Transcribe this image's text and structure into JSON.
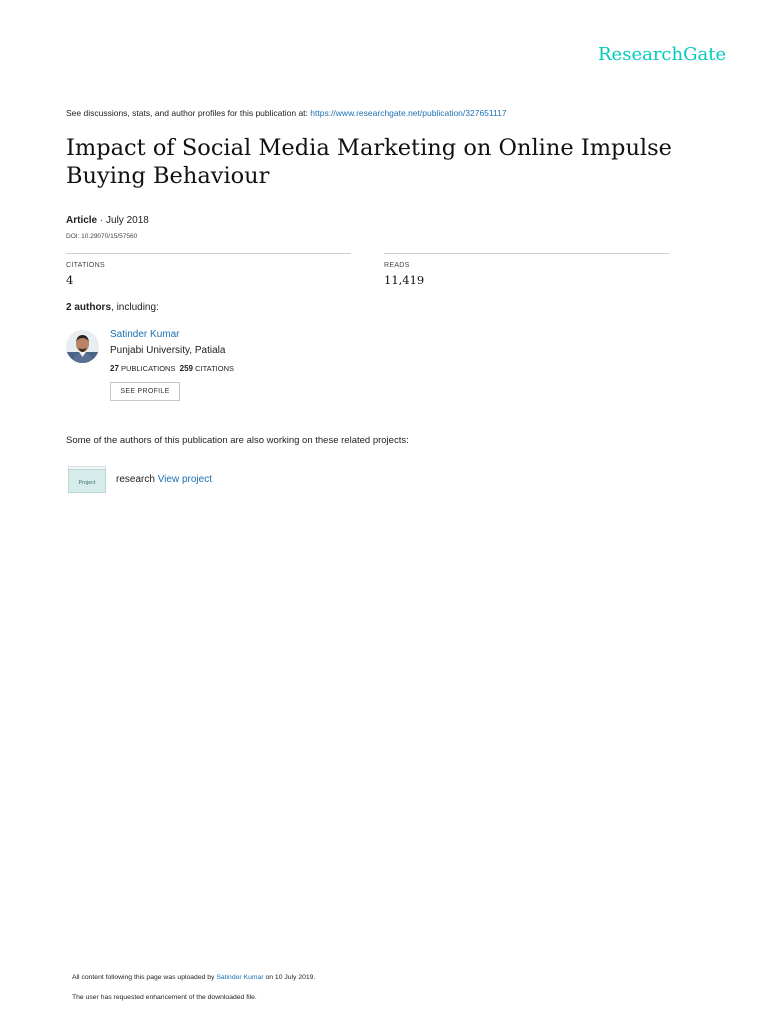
{
  "header": {
    "logo_text": "ResearchGate",
    "logo_color": "#00ccbb",
    "discuss_text": "See discussions, stats, and author profiles for this publication at: ",
    "publication_url": "https://www.researchgate.net/publication/327651117"
  },
  "publication": {
    "title": "Impact of Social Media Marketing on Online Impulse Buying Behaviour",
    "type": "Article",
    "date_text": " · July 2018",
    "doi": "DOI: 10.29070/15/57560"
  },
  "stats": {
    "citations_label": "CITATIONS",
    "citations_value": "4",
    "reads_label": "READS",
    "reads_value": "11,419"
  },
  "authors": {
    "count_text": "2 authors",
    "count_suffix": ", including:",
    "items": [
      {
        "name": "Satinder Kumar",
        "institution": "Punjabi University, Patiala",
        "publications_count": "27",
        "publications_label": "PUBLICATIONS",
        "citations_count": "259",
        "citations_label": "CITATIONS",
        "button_label": "SEE PROFILE"
      }
    ]
  },
  "projects": {
    "heading": "Some of the authors of this publication are also working on these related projects:",
    "items": [
      {
        "icon_label": "Project",
        "name": "research",
        "link_label": "View project"
      }
    ]
  },
  "footer": {
    "upload_prefix": "All content following this page was uploaded by ",
    "uploader": "Satinder Kumar",
    "upload_suffix": " on 10 July 2019.",
    "note": "The user has requested enhancement of the downloaded file."
  },
  "colors": {
    "link": "#1b6fb3",
    "brand": "#00ccbb"
  }
}
